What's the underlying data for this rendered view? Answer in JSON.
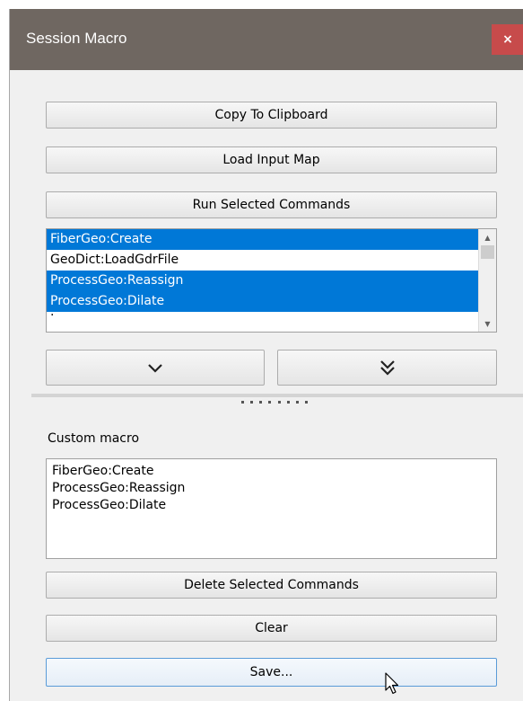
{
  "window": {
    "title": "Session Macro",
    "close_icon": "close-icon",
    "close_glyph": "×"
  },
  "buttons": {
    "copy_to_clipboard": "Copy To Clipboard",
    "load_input_map": "Load Input Map",
    "run_selected": "Run Selected Commands",
    "move_down_icon": "chevron-down-icon",
    "move_bottom_icon": "double-chevron-down-icon",
    "delete_selected": "Delete Selected Commands",
    "clear": "Clear",
    "save": "Save..."
  },
  "command_list": {
    "items": [
      {
        "label": "FiberGeo:Create",
        "selected": true
      },
      {
        "label": "GeoDict:LoadGdrFile",
        "selected": false
      },
      {
        "label": "ProcessGeo:Reassign",
        "selected": true
      },
      {
        "label": "ProcessGeo:Dilate",
        "selected": true
      },
      {
        "label": "·",
        "selected": false
      }
    ]
  },
  "custom_macro": {
    "label": "Custom macro",
    "lines": [
      "FiberGeo:Create",
      "ProcessGeo:Reassign",
      "ProcessGeo:Dilate"
    ]
  },
  "colors": {
    "titlebar": "#6f6761",
    "close_button": "#c74b4b",
    "selection": "#0078d7"
  }
}
